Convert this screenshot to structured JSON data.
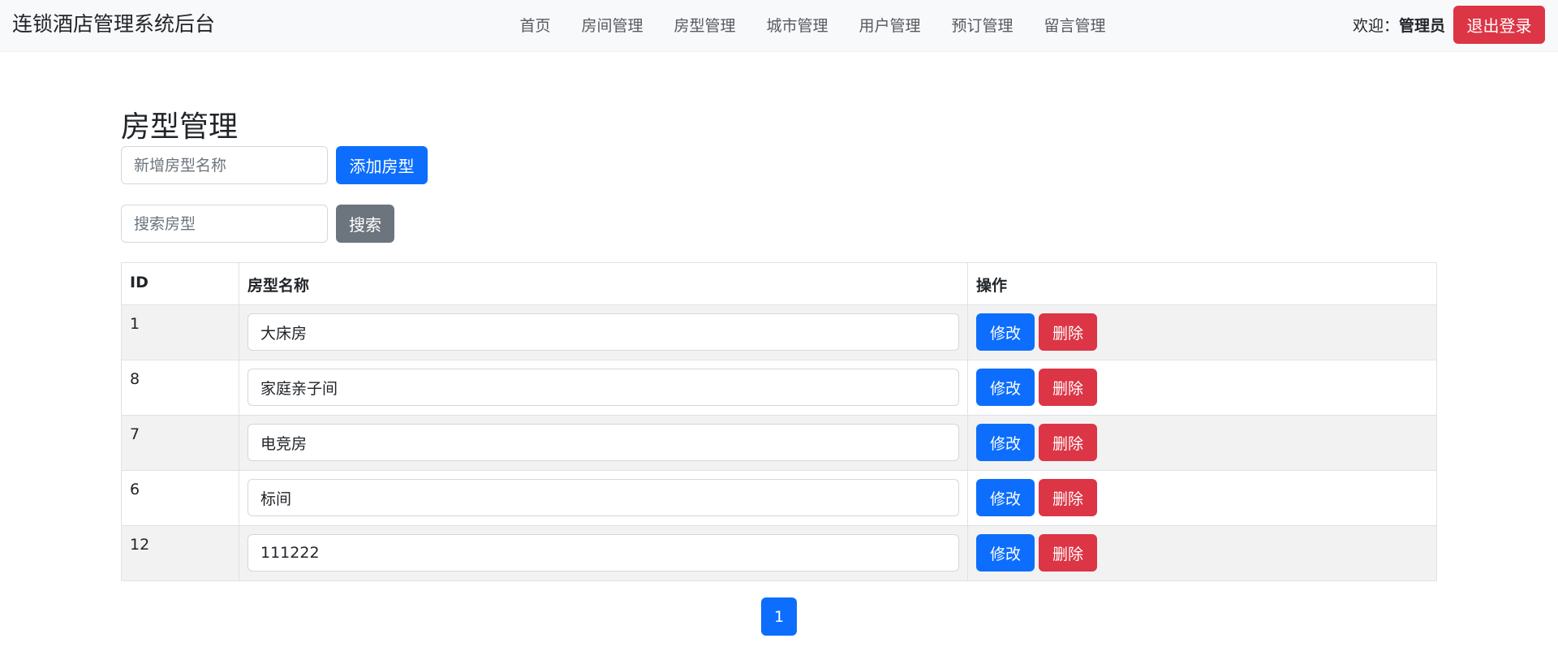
{
  "app": {
    "brand": "连锁酒店管理系统后台"
  },
  "nav": {
    "items": [
      {
        "label": "首页"
      },
      {
        "label": "房间管理"
      },
      {
        "label": "房型管理"
      },
      {
        "label": "城市管理"
      },
      {
        "label": "用户管理"
      },
      {
        "label": "预订管理"
      },
      {
        "label": "留言管理"
      }
    ],
    "welcome_prefix": "欢迎：",
    "username": "管理员",
    "logout_label": "退出登录"
  },
  "page": {
    "title": "房型管理",
    "add": {
      "placeholder": "新增房型名称",
      "button_label": "添加房型"
    },
    "search": {
      "placeholder": "搜索房型",
      "button_label": "搜索"
    }
  },
  "table": {
    "headers": {
      "id": "ID",
      "name": "房型名称",
      "actions": "操作"
    },
    "edit_label": "修改",
    "delete_label": "删除",
    "rows": [
      {
        "id": "1",
        "name": "大床房"
      },
      {
        "id": "8",
        "name": "家庭亲子间"
      },
      {
        "id": "7",
        "name": "电竞房"
      },
      {
        "id": "6",
        "name": "标间"
      },
      {
        "id": "12",
        "name": "111222"
      }
    ]
  },
  "pagination": {
    "current_page": "1"
  },
  "colors": {
    "primary": "#0d6efd",
    "danger": "#dc3545",
    "secondary": "#6c757d",
    "navbar_bg": "#f8f9fa",
    "striped_row": "#f2f2f2"
  }
}
